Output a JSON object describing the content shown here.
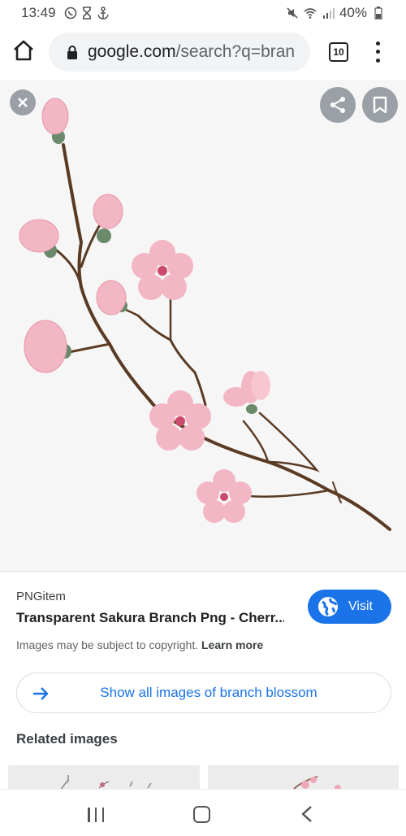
{
  "status_bar": {
    "time": "13:49",
    "battery": "40%"
  },
  "address_bar": {
    "url_host": "google.com",
    "url_path": "/search?q=bran",
    "tab_count": "10"
  },
  "info": {
    "source": "PNGitem",
    "title": "Transparent Sakura Branch Png - Cherr...",
    "visit_label": "Visit",
    "copyright_text": "Images may be subject to copyright.",
    "learn_more": "Learn more",
    "show_all_label": "Show all images of branch blossom",
    "related_heading": "Related images"
  },
  "colors": {
    "accent": "#1a73e8",
    "blossom": "#f3b6c4",
    "branch": "#5a3a22"
  },
  "icons": [
    "whatsapp-icon",
    "hourglass-icon",
    "anchor-icon",
    "mute-icon",
    "wifi-icon",
    "signal-icon",
    "battery-icon",
    "home-icon",
    "lock-icon",
    "tabs-icon",
    "more-vert-icon",
    "close-icon",
    "share-icon",
    "bookmark-icon",
    "globe-icon",
    "arrow-right-icon",
    "recents-icon",
    "nav-home-icon",
    "back-icon"
  ]
}
